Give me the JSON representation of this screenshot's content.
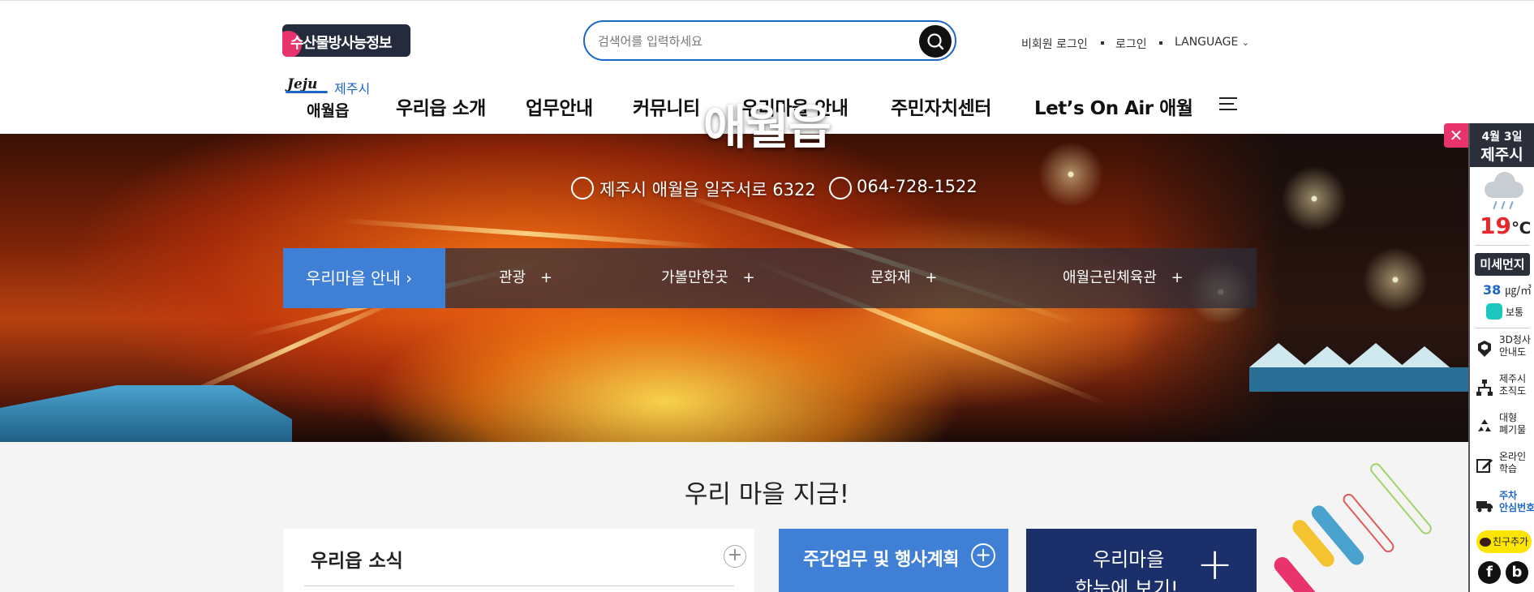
{
  "header": {
    "badge": "수산물방사능정보",
    "search": {
      "placeholder": "검색어를 입력하세요"
    },
    "util": {
      "guest_login": "비회원 로그인",
      "login": "로그인",
      "language": "LANGUAGE"
    },
    "logo": {
      "jeju": "Jeju",
      "city": "제주시",
      "town": "애월읍"
    },
    "gnb": [
      "우리읍 소개",
      "업무안내",
      "커뮤니티",
      "우리마을 안내",
      "주민자치센터",
      "Let’s On Air 애월"
    ]
  },
  "hero": {
    "title": "애월읍",
    "address": "제주시 애월읍 일주서로 6322",
    "phone": "064-728-1522",
    "subnav_active": "우리마을 안내",
    "subnav": [
      "관광",
      "가볼만한곳",
      "문화재",
      "애월근린체육관"
    ]
  },
  "content": {
    "section_title": "우리 마을 지금!",
    "news_title": "우리읍 소식",
    "weekly_title": "주간업무 및 행사계획",
    "village_line1": "우리마을",
    "village_line2": "한눈에 보기!"
  },
  "quick_panel": {
    "date": "4월 3일",
    "city": "제주시",
    "temp": "19",
    "temp_unit": "℃",
    "dust_label": "미세먼지",
    "dust_value": "38",
    "dust_unit": "㎍/㎥",
    "dust_status": "보통",
    "items": [
      {
        "line1": "3D청사",
        "line2": "안내도"
      },
      {
        "line1": "제주시",
        "line2": "조직도"
      },
      {
        "line1": "대형",
        "line2": "폐기물"
      },
      {
        "line1": "온라인",
        "line2": "학습"
      },
      {
        "line1": "주차",
        "line2": "안심번호"
      }
    ],
    "kakao": "친구추가",
    "colors": {
      "accent_blue": "#3f7fd6",
      "navy": "#1b2f6a",
      "pink": "#e8336d"
    }
  }
}
